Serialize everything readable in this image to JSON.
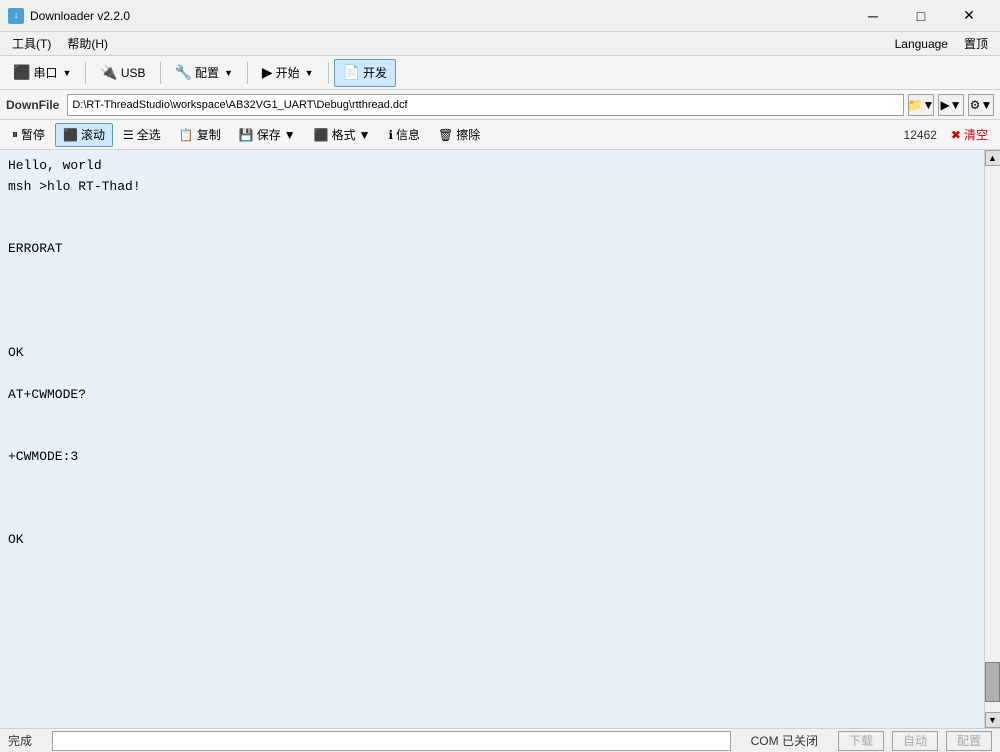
{
  "titlebar": {
    "icon": "↓",
    "title": "Downloader v2.2.0",
    "minimize": "─",
    "maximize": "□",
    "close": "✕"
  },
  "menubar": {
    "items": [
      {
        "label": "工具(T)"
      },
      {
        "label": "帮助(H)"
      }
    ],
    "right_items": [
      {
        "label": "Language"
      },
      {
        "label": "置顶"
      }
    ]
  },
  "toolbar": {
    "items": [
      {
        "id": "serial",
        "icon": "⬛",
        "label": "串口",
        "has_dropdown": true
      },
      {
        "id": "usb",
        "icon": "⬛",
        "label": "USB",
        "has_dropdown": false
      },
      {
        "id": "config",
        "icon": "🔧",
        "label": "配置",
        "has_dropdown": true
      },
      {
        "id": "start",
        "icon": "▶",
        "label": "开始",
        "has_dropdown": true
      },
      {
        "id": "develop",
        "icon": "📄",
        "label": "开发",
        "has_dropdown": false,
        "active": true
      }
    ]
  },
  "downfile": {
    "label": "DownFile",
    "path": "D:\\RT-ThreadStudio\\workspace\\AB32VG1_UART\\Debug\\rtthread.dcf",
    "btn1": "...",
    "btn2": "▶",
    "btn3": "⚙"
  },
  "sec_toolbar": {
    "items": [
      {
        "id": "pause",
        "icon": "⏸",
        "label": "暂停"
      },
      {
        "id": "scroll",
        "icon": "⬛",
        "label": "滚动",
        "active": true
      },
      {
        "id": "selectall",
        "icon": "☰",
        "label": "全选"
      },
      {
        "id": "copy",
        "icon": "📋",
        "label": "复制"
      },
      {
        "id": "save",
        "icon": "💾",
        "label": "保存",
        "has_dropdown": true
      },
      {
        "id": "format",
        "icon": "⬛",
        "label": "格式",
        "has_dropdown": true
      },
      {
        "id": "info",
        "icon": "ℹ",
        "label": "信息"
      },
      {
        "id": "clear_btn",
        "icon": "🗑",
        "label": "擦除"
      }
    ],
    "count": "12462",
    "clear": "清空"
  },
  "terminal": {
    "lines": [
      "Hello, world",
      "msh >hlo RT-Thad!",
      "",
      "",
      "ERRORAT",
      "",
      "",
      "",
      "",
      "OK",
      "",
      "AT+CWMODE?",
      "",
      "",
      "+CWMODE:3",
      "",
      "",
      "",
      "OK",
      "",
      ""
    ]
  },
  "statusbar": {
    "status": "完成",
    "com_status": "COM 已关闭",
    "btn_download": "下载",
    "btn_autostart": "自动",
    "btn_config": "配置"
  }
}
